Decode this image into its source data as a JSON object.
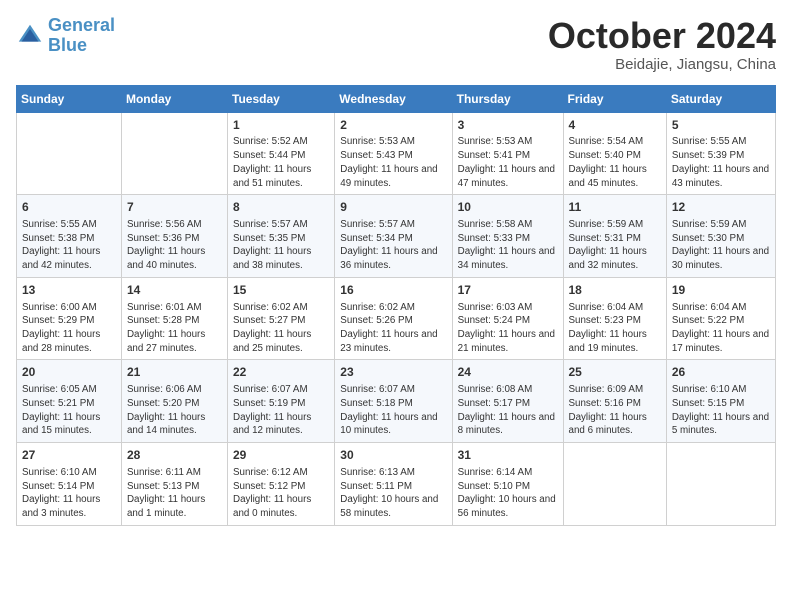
{
  "header": {
    "logo_line1": "General",
    "logo_line2": "Blue",
    "month": "October 2024",
    "location": "Beidajie, Jiangsu, China"
  },
  "weekdays": [
    "Sunday",
    "Monday",
    "Tuesday",
    "Wednesday",
    "Thursday",
    "Friday",
    "Saturday"
  ],
  "weeks": [
    [
      {
        "day": "",
        "text": ""
      },
      {
        "day": "",
        "text": ""
      },
      {
        "day": "1",
        "text": "Sunrise: 5:52 AM\nSunset: 5:44 PM\nDaylight: 11 hours and 51 minutes."
      },
      {
        "day": "2",
        "text": "Sunrise: 5:53 AM\nSunset: 5:43 PM\nDaylight: 11 hours and 49 minutes."
      },
      {
        "day": "3",
        "text": "Sunrise: 5:53 AM\nSunset: 5:41 PM\nDaylight: 11 hours and 47 minutes."
      },
      {
        "day": "4",
        "text": "Sunrise: 5:54 AM\nSunset: 5:40 PM\nDaylight: 11 hours and 45 minutes."
      },
      {
        "day": "5",
        "text": "Sunrise: 5:55 AM\nSunset: 5:39 PM\nDaylight: 11 hours and 43 minutes."
      }
    ],
    [
      {
        "day": "6",
        "text": "Sunrise: 5:55 AM\nSunset: 5:38 PM\nDaylight: 11 hours and 42 minutes."
      },
      {
        "day": "7",
        "text": "Sunrise: 5:56 AM\nSunset: 5:36 PM\nDaylight: 11 hours and 40 minutes."
      },
      {
        "day": "8",
        "text": "Sunrise: 5:57 AM\nSunset: 5:35 PM\nDaylight: 11 hours and 38 minutes."
      },
      {
        "day": "9",
        "text": "Sunrise: 5:57 AM\nSunset: 5:34 PM\nDaylight: 11 hours and 36 minutes."
      },
      {
        "day": "10",
        "text": "Sunrise: 5:58 AM\nSunset: 5:33 PM\nDaylight: 11 hours and 34 minutes."
      },
      {
        "day": "11",
        "text": "Sunrise: 5:59 AM\nSunset: 5:31 PM\nDaylight: 11 hours and 32 minutes."
      },
      {
        "day": "12",
        "text": "Sunrise: 5:59 AM\nSunset: 5:30 PM\nDaylight: 11 hours and 30 minutes."
      }
    ],
    [
      {
        "day": "13",
        "text": "Sunrise: 6:00 AM\nSunset: 5:29 PM\nDaylight: 11 hours and 28 minutes."
      },
      {
        "day": "14",
        "text": "Sunrise: 6:01 AM\nSunset: 5:28 PM\nDaylight: 11 hours and 27 minutes."
      },
      {
        "day": "15",
        "text": "Sunrise: 6:02 AM\nSunset: 5:27 PM\nDaylight: 11 hours and 25 minutes."
      },
      {
        "day": "16",
        "text": "Sunrise: 6:02 AM\nSunset: 5:26 PM\nDaylight: 11 hours and 23 minutes."
      },
      {
        "day": "17",
        "text": "Sunrise: 6:03 AM\nSunset: 5:24 PM\nDaylight: 11 hours and 21 minutes."
      },
      {
        "day": "18",
        "text": "Sunrise: 6:04 AM\nSunset: 5:23 PM\nDaylight: 11 hours and 19 minutes."
      },
      {
        "day": "19",
        "text": "Sunrise: 6:04 AM\nSunset: 5:22 PM\nDaylight: 11 hours and 17 minutes."
      }
    ],
    [
      {
        "day": "20",
        "text": "Sunrise: 6:05 AM\nSunset: 5:21 PM\nDaylight: 11 hours and 15 minutes."
      },
      {
        "day": "21",
        "text": "Sunrise: 6:06 AM\nSunset: 5:20 PM\nDaylight: 11 hours and 14 minutes."
      },
      {
        "day": "22",
        "text": "Sunrise: 6:07 AM\nSunset: 5:19 PM\nDaylight: 11 hours and 12 minutes."
      },
      {
        "day": "23",
        "text": "Sunrise: 6:07 AM\nSunset: 5:18 PM\nDaylight: 11 hours and 10 minutes."
      },
      {
        "day": "24",
        "text": "Sunrise: 6:08 AM\nSunset: 5:17 PM\nDaylight: 11 hours and 8 minutes."
      },
      {
        "day": "25",
        "text": "Sunrise: 6:09 AM\nSunset: 5:16 PM\nDaylight: 11 hours and 6 minutes."
      },
      {
        "day": "26",
        "text": "Sunrise: 6:10 AM\nSunset: 5:15 PM\nDaylight: 11 hours and 5 minutes."
      }
    ],
    [
      {
        "day": "27",
        "text": "Sunrise: 6:10 AM\nSunset: 5:14 PM\nDaylight: 11 hours and 3 minutes."
      },
      {
        "day": "28",
        "text": "Sunrise: 6:11 AM\nSunset: 5:13 PM\nDaylight: 11 hours and 1 minute."
      },
      {
        "day": "29",
        "text": "Sunrise: 6:12 AM\nSunset: 5:12 PM\nDaylight: 11 hours and 0 minutes."
      },
      {
        "day": "30",
        "text": "Sunrise: 6:13 AM\nSunset: 5:11 PM\nDaylight: 10 hours and 58 minutes."
      },
      {
        "day": "31",
        "text": "Sunrise: 6:14 AM\nSunset: 5:10 PM\nDaylight: 10 hours and 56 minutes."
      },
      {
        "day": "",
        "text": ""
      },
      {
        "day": "",
        "text": ""
      }
    ]
  ]
}
